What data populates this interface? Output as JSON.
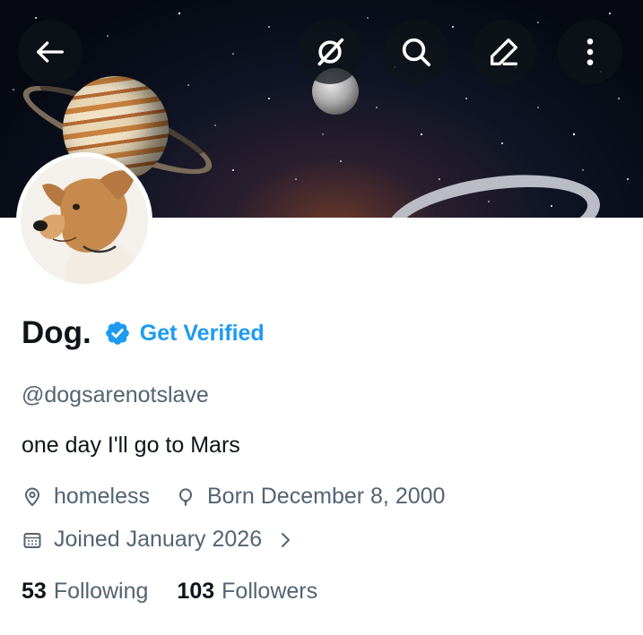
{
  "profile": {
    "display_name": "Dog.",
    "get_verified_label": "Get Verified",
    "handle": "@dogsarenotslave",
    "bio": "one day I'll go to Mars",
    "location": "homeless",
    "birthday": "Born December 8, 2000",
    "joined": "Joined January 2026",
    "following_count": "53",
    "following_label": "Following",
    "followers_count": "103",
    "followers_label": "Followers"
  },
  "header_buttons": {
    "back_icon": "arrow-left-icon",
    "grok_icon": "grok-icon",
    "search_icon": "search-icon",
    "edit_icon": "pencil-icon",
    "more_icon": "more-vertical-icon"
  },
  "colors": {
    "accent": "#1d9bf0",
    "text_primary": "#0f1419",
    "text_secondary": "#536471"
  }
}
